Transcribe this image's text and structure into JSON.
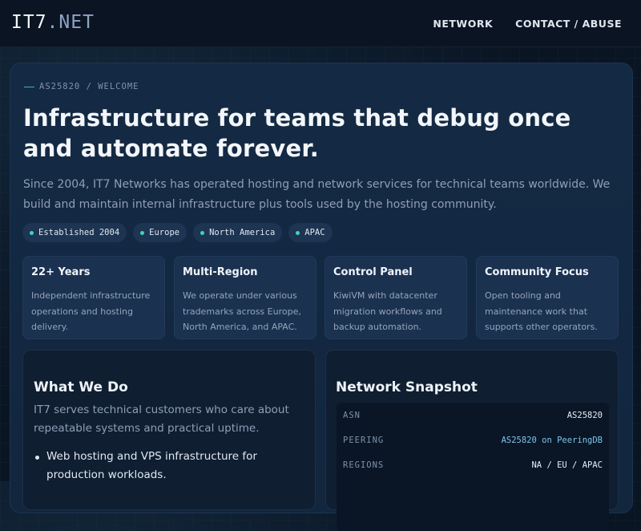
{
  "header": {
    "logo_main": "IT7",
    "logo_suffix": ".NET",
    "nav": [
      {
        "label": "NETWORK"
      },
      {
        "label": "CONTACT / ABUSE"
      }
    ]
  },
  "hero": {
    "eyebrow": "AS25820 / WELCOME",
    "title": "Infrastructure for teams that debug once and automate forever.",
    "description": "Since 2004, IT7 Networks has operated hosting and network services for technical teams worldwide. We build and maintain internal infrastructure plus tools used by the hosting community.",
    "tags": [
      "Established 2004",
      "Europe",
      "North America",
      "APAC"
    ]
  },
  "features": [
    {
      "title": "22+ Years",
      "text": "Independent infrastructure operations and hosting delivery."
    },
    {
      "title": "Multi-Region",
      "text": "We operate under various trademarks across Europe, North America, and APAC."
    },
    {
      "title": "Control Panel",
      "text": "KiwiVM with datacenter migration workflows and backup automation."
    },
    {
      "title": "Community Focus",
      "text": "Open tooling and maintenance work that supports other operators."
    }
  ],
  "what_we_do": {
    "title": "What We Do",
    "text": "IT7 serves technical customers who care about repeatable systems and practical uptime.",
    "items": [
      "Web hosting and VPS infrastructure for production workloads."
    ]
  },
  "snapshot": {
    "title": "Network Snapshot",
    "rows": [
      {
        "key": "ASN",
        "value": "AS25820"
      },
      {
        "key": "PEERING",
        "value": "AS25820 on PeeringDB"
      },
      {
        "key": "REGIONS",
        "value": "NA / EU / APAC"
      }
    ]
  },
  "colors": {
    "accent_teal": "#3fd6b5",
    "link_blue": "#7fc4e8",
    "background": "#0a1524",
    "panel": "#142a44"
  }
}
